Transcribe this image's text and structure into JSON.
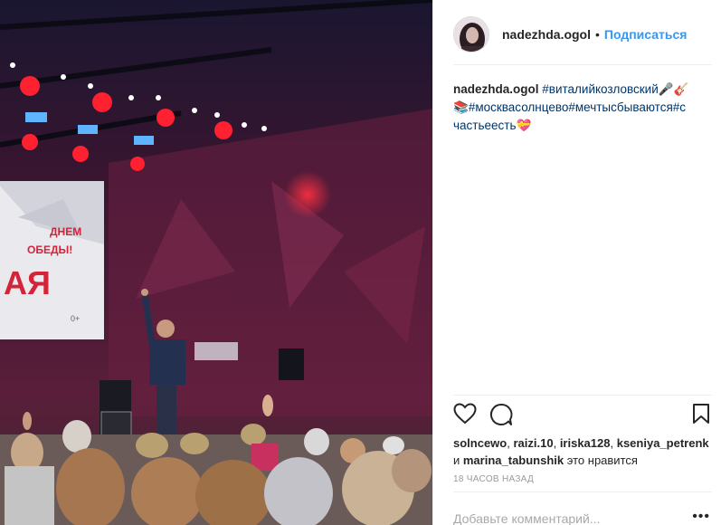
{
  "post": {
    "username": "nadezhda.ogol",
    "separator": "•",
    "follow_label": "Подписаться",
    "caption": {
      "username": "nadezhda.ogol",
      "parts": [
        "#виталийкозловский",
        "🎤🎸",
        "📚",
        "#москвасолнцево",
        "#мечтысбываются",
        "#счастьеесть",
        "💝"
      ]
    },
    "screen_text": {
      "line1": "ДНЕМ",
      "line2": "ОБЕДЫ!",
      "big": "АЯ",
      "age": "0+"
    },
    "likes": {
      "users": [
        "solncewo",
        "raizi.10",
        "iriska128",
        "kseniya_petrenk",
        "marina_tabunshik"
      ],
      "and_word": "и",
      "suffix": "это нравится"
    },
    "timestamp": "18 ЧАСОВ НАЗАД",
    "comment_placeholder": "Добавьте комментарий...",
    "more_label": "•••"
  },
  "icons": {
    "like": "heart-icon",
    "comment": "comment-icon",
    "save": "bookmark-icon"
  }
}
